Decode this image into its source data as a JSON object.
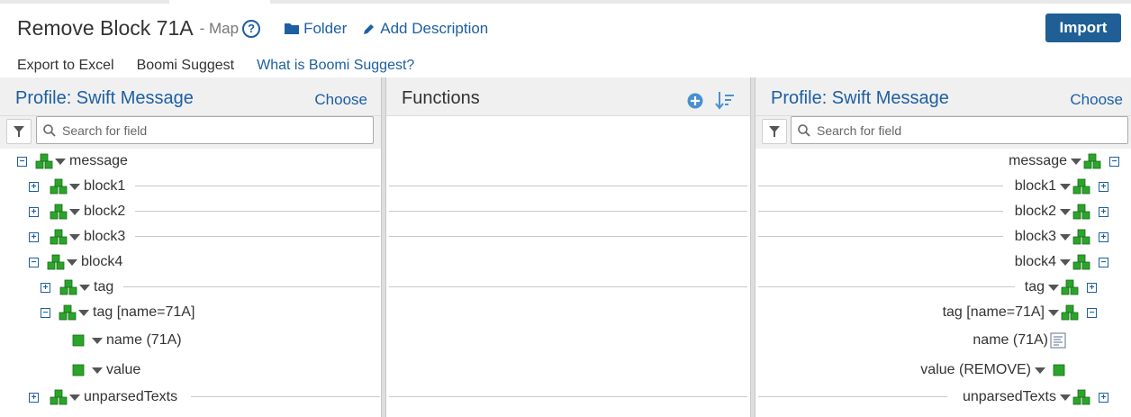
{
  "header": {
    "title": "Remove Block 71A",
    "subtitle": "- Map",
    "help_icon": "question-circle-icon",
    "folder_label": "Folder",
    "description_label": "Add Description",
    "import_label": "Import",
    "export_label": "Export to Excel",
    "suggest_label": "Boomi Suggest",
    "what_is_label": "What is Boomi Suggest?"
  },
  "left_panel": {
    "title": "Profile: Swift Message",
    "choose_label": "Choose",
    "search_placeholder": "Search for field",
    "rows": [
      {
        "label": "message",
        "expander": "⊟",
        "icon": "element-group-icon"
      },
      {
        "label": "block1",
        "expander": "⊞",
        "icon": "element-group-icon"
      },
      {
        "label": "block2",
        "expander": "⊞",
        "icon": "element-group-icon"
      },
      {
        "label": "block3",
        "expander": "⊞",
        "icon": "element-group-icon"
      },
      {
        "label": "block4",
        "expander": "⊟",
        "icon": "element-group-icon"
      },
      {
        "label": "tag",
        "expander": "⊞",
        "icon": "element-group-icon"
      },
      {
        "label": "tag [name=71A]",
        "expander": "⊟",
        "icon": "element-group-icon"
      },
      {
        "label": "name (71A)",
        "icon": "element-field-icon"
      },
      {
        "label": "value",
        "icon": "element-field-icon"
      },
      {
        "label": "unparsedTexts",
        "expander": "⊞",
        "icon": "element-group-icon"
      }
    ]
  },
  "functions_panel": {
    "title": "Functions",
    "add_icon": "plus-circle-icon",
    "sort_icon": "sort-icon"
  },
  "right_panel": {
    "title": "Profile: Swift Message",
    "choose_label": "Choose",
    "search_placeholder": "Search for field",
    "rows": [
      {
        "label": "message",
        "expander": "⊟",
        "icon": "element-group-icon"
      },
      {
        "label": "block1",
        "expander": "⊞",
        "icon": "element-group-icon"
      },
      {
        "label": "block2",
        "expander": "⊞",
        "icon": "element-group-icon"
      },
      {
        "label": "block3",
        "expander": "⊞",
        "icon": "element-group-icon"
      },
      {
        "label": "block4",
        "expander": "⊟",
        "icon": "element-group-icon"
      },
      {
        "label": "tag",
        "expander": "⊞",
        "icon": "element-group-icon"
      },
      {
        "label": "tag [name=71A]",
        "expander": "⊟",
        "icon": "element-group-icon"
      },
      {
        "label": "name (71A)",
        "icon": "default-value-icon"
      },
      {
        "label": "value (REMOVE)",
        "icon": "element-field-icon"
      },
      {
        "label": "unparsedTexts",
        "expander": "⊞",
        "icon": "element-group-icon"
      }
    ]
  },
  "colors": {
    "link": "#1d5fa2",
    "import_button": "#1f5f96",
    "icon_green": "#2aa52a"
  }
}
